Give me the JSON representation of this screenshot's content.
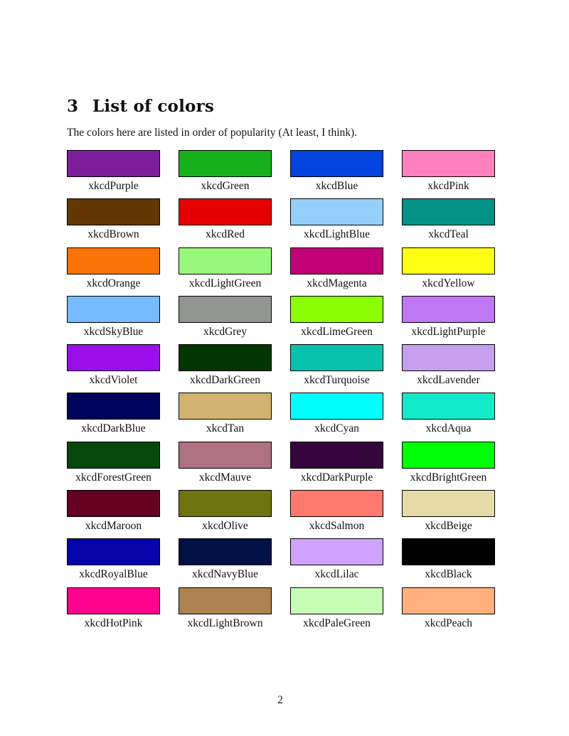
{
  "section": {
    "number": "3",
    "title": "List of colors",
    "intro": "The colors here are listed in order of popularity (At least, I think)."
  },
  "colors": [
    {
      "name": "xkcdPurple",
      "hex": "#7e1e9c"
    },
    {
      "name": "xkcdGreen",
      "hex": "#15b01a"
    },
    {
      "name": "xkcdBlue",
      "hex": "#0343df"
    },
    {
      "name": "xkcdPink",
      "hex": "#ff81c0"
    },
    {
      "name": "xkcdBrown",
      "hex": "#653700"
    },
    {
      "name": "xkcdRed",
      "hex": "#e50000"
    },
    {
      "name": "xkcdLightBlue",
      "hex": "#95d0fc"
    },
    {
      "name": "xkcdTeal",
      "hex": "#029386"
    },
    {
      "name": "xkcdOrange",
      "hex": "#f97306"
    },
    {
      "name": "xkcdLightGreen",
      "hex": "#96f97b"
    },
    {
      "name": "xkcdMagenta",
      "hex": "#c20078"
    },
    {
      "name": "xkcdYellow",
      "hex": "#ffff14"
    },
    {
      "name": "xkcdSkyBlue",
      "hex": "#75bbfd"
    },
    {
      "name": "xkcdGrey",
      "hex": "#929591"
    },
    {
      "name": "xkcdLimeGreen",
      "hex": "#89fe05"
    },
    {
      "name": "xkcdLightPurple",
      "hex": "#bf77f6"
    },
    {
      "name": "xkcdViolet",
      "hex": "#9a0eea"
    },
    {
      "name": "xkcdDarkGreen",
      "hex": "#033500"
    },
    {
      "name": "xkcdTurquoise",
      "hex": "#06c2ac"
    },
    {
      "name": "xkcdLavender",
      "hex": "#c79fef"
    },
    {
      "name": "xkcdDarkBlue",
      "hex": "#00035b"
    },
    {
      "name": "xkcdTan",
      "hex": "#d1b26f"
    },
    {
      "name": "xkcdCyan",
      "hex": "#00ffff"
    },
    {
      "name": "xkcdAqua",
      "hex": "#13eac9"
    },
    {
      "name": "xkcdForestGreen",
      "hex": "#06470c"
    },
    {
      "name": "xkcdMauve",
      "hex": "#ae7181"
    },
    {
      "name": "xkcdDarkPurple",
      "hex": "#35063e"
    },
    {
      "name": "xkcdBrightGreen",
      "hex": "#01ff07"
    },
    {
      "name": "xkcdMaroon",
      "hex": "#650021"
    },
    {
      "name": "xkcdOlive",
      "hex": "#6e750e"
    },
    {
      "name": "xkcdSalmon",
      "hex": "#ff796c"
    },
    {
      "name": "xkcdBeige",
      "hex": "#e6daa6"
    },
    {
      "name": "xkcdRoyalBlue",
      "hex": "#0504aa"
    },
    {
      "name": "xkcdNavyBlue",
      "hex": "#001146"
    },
    {
      "name": "xkcdLilac",
      "hex": "#cea2fd"
    },
    {
      "name": "xkcdBlack",
      "hex": "#000000"
    },
    {
      "name": "xkcdHotPink",
      "hex": "#ff028d"
    },
    {
      "name": "xkcdLightBrown",
      "hex": "#ad8150"
    },
    {
      "name": "xkcdPaleGreen",
      "hex": "#c7fdb5"
    },
    {
      "name": "xkcdPeach",
      "hex": "#ffb07c"
    }
  ],
  "footer": {
    "page_number": "2"
  }
}
